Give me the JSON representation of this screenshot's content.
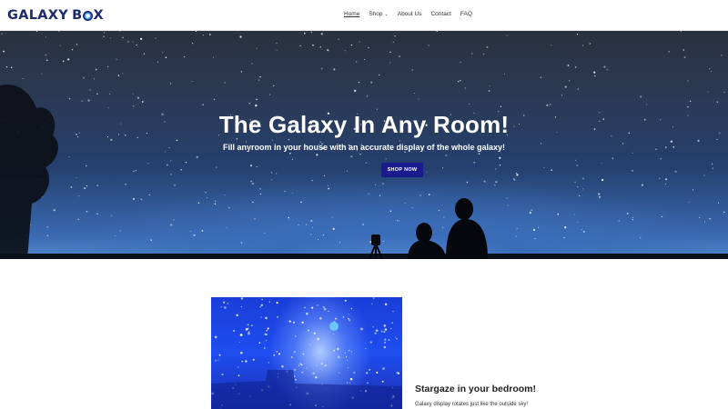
{
  "header": {
    "logo_text_1": "GALAXY B",
    "logo_text_2": "X",
    "logo_word_1": "GALAXY",
    "logo_word_2": "BOX"
  },
  "nav": {
    "items": [
      {
        "label": "Home",
        "active": true
      },
      {
        "label": "Shop",
        "has_dropdown": true
      },
      {
        "label": "About Us"
      },
      {
        "label": "Contact"
      },
      {
        "label": "FAQ"
      }
    ]
  },
  "hero": {
    "title": "The Galaxy In Any Room!",
    "subtitle": "Fill anyroom in your house with an accurate display of the whole galaxy!",
    "button_label": "SHOP NOW"
  },
  "feature": {
    "title": "Stargaze in your bedroom!",
    "text": "Galaxy display rotates just like the outside sky!"
  },
  "colors": {
    "brand": "#1b2a6b",
    "button": "#1b1b8f"
  }
}
